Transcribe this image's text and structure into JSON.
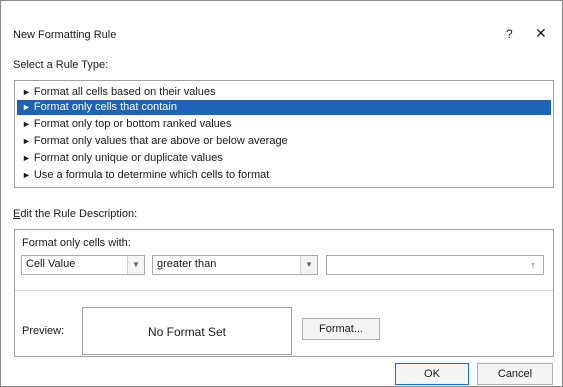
{
  "window": {
    "title": "New Formatting Rule",
    "help_label": "?",
    "close_label": "✕"
  },
  "rule_type": {
    "label": "Select a Rule Type:",
    "items": [
      {
        "label": "Format all cells based on their values",
        "selected": false
      },
      {
        "label": "Format only cells that contain",
        "selected": true
      },
      {
        "label": "Format only top or bottom ranked values",
        "selected": false
      },
      {
        "label": "Format only values that are above or below average",
        "selected": false
      },
      {
        "label": "Format only unique or duplicate values",
        "selected": false
      },
      {
        "label": "Use a formula to determine which cells to format",
        "selected": false
      }
    ],
    "arrow_glyph": "►"
  },
  "description": {
    "label_first": "E",
    "label_rest": "dit the Rule Description:",
    "format_only_label": "Format only cells with:",
    "condition_field": "Cell Value",
    "operator": "greater than",
    "value_input": "",
    "ref_icon": "↑",
    "preview_label": "Preview:",
    "preview_text": "No Format Set",
    "format_button": "Format..."
  },
  "footer": {
    "ok_label": "OK",
    "cancel_label": "Cancel"
  },
  "colors": {
    "selection": "#1e63ba",
    "primary_border": "#0078d7"
  }
}
